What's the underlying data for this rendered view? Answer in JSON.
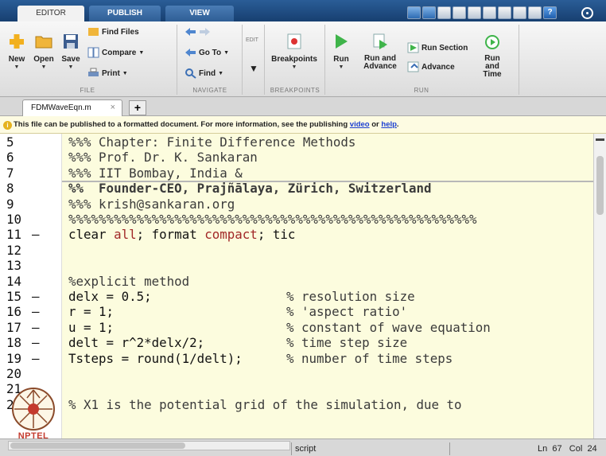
{
  "tabs": [
    {
      "label": "EDITOR",
      "active": true
    },
    {
      "label": "PUBLISH",
      "active": false
    },
    {
      "label": "VIEW",
      "active": false
    }
  ],
  "ribbon": {
    "new": "New",
    "open": "Open",
    "save": "Save",
    "find_files": "Find Files",
    "compare": "Compare",
    "print": "Print",
    "go_to": "Go To",
    "find": "Find",
    "edit": "EDIT",
    "breakpoints": "Breakpoints",
    "run": "Run",
    "run_and_advance": "Run and Advance",
    "run_section": "Run Section",
    "advance": "Advance",
    "run_and_time": "Run and Time",
    "group_file": "FILE",
    "group_navigate": "NAVIGATE",
    "group_breakpoints": "BREAKPOINTS",
    "group_run": "RUN"
  },
  "file_tab": {
    "name": "FDMWaveEqn.m",
    "close": "×",
    "add": "+"
  },
  "info_bar": {
    "text": "This file can be published to a formatted document. For more information, see the publishing",
    "link_video": "video",
    "or": "or",
    "link_help": "help",
    "dot": "."
  },
  "code_lines": [
    {
      "n": "5",
      "mark": "",
      "text": "%%% Chapter: Finite Difference Methods"
    },
    {
      "n": "6",
      "mark": "",
      "text": "%%% Prof. Dr. K. Sankaran"
    },
    {
      "n": "7",
      "mark": "",
      "text": "%%% IIT Bombay, India &"
    },
    {
      "n": "8",
      "mark": "",
      "text": "%%  Founder-CEO, Prajñālaya, Zürich, Switzerland"
    },
    {
      "n": "9",
      "mark": "",
      "text": "%%% krish@sankaran.org"
    },
    {
      "n": "10",
      "mark": "",
      "text": "%%%%%%%%%%%%%%%%%%%%%%%%%%%%%%%%%%%%%%%%%%%%%%%%%%%%%%"
    },
    {
      "n": "11",
      "mark": "–",
      "text": "clear all; format compact; tic"
    },
    {
      "n": "12",
      "mark": "",
      "text": ""
    },
    {
      "n": "13",
      "mark": "",
      "text": ""
    },
    {
      "n": "14",
      "mark": "",
      "text": "%explicit method"
    },
    {
      "n": "15",
      "mark": "–",
      "text": "delx = 0.5;",
      "comment": "% resolution size"
    },
    {
      "n": "16",
      "mark": "–",
      "text": "r = 1;",
      "comment": "% 'aspect ratio'"
    },
    {
      "n": "17",
      "mark": "–",
      "text": "u = 1;",
      "comment": "% constant of wave equation"
    },
    {
      "n": "18",
      "mark": "–",
      "text": "delt = r^2*delx/2;",
      "comment": "% time step size"
    },
    {
      "n": "19",
      "mark": "–",
      "text": "Tsteps = round(1/delt);",
      "comment": "% number of time steps"
    },
    {
      "n": "20",
      "mark": "",
      "text": ""
    },
    {
      "n": "21",
      "mark": "",
      "text": ""
    },
    {
      "n": "22",
      "mark": "",
      "text": "% X1 is the potential grid of the simulation, due to"
    }
  ],
  "status": {
    "mode": "script",
    "ln_label": "Ln",
    "ln": "67",
    "col_label": "Col",
    "col": "24"
  },
  "logo": {
    "text": "NPTEL"
  },
  "colors": {
    "tab_bar": "#173f70",
    "cell_bg": "#fcfcde",
    "keyword": "#a12727",
    "link": "#1a3fd1"
  }
}
